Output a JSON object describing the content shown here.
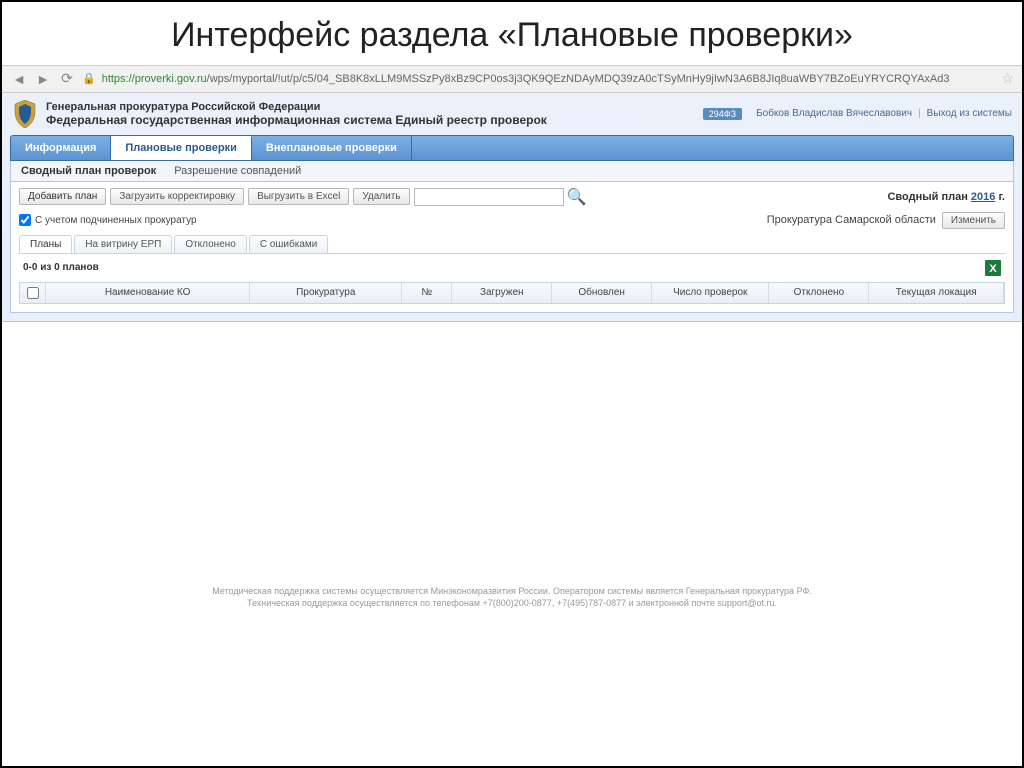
{
  "slide_title": "Интерфейс раздела «Плановые проверки»",
  "browser": {
    "url_host": "https://proverki.gov.ru",
    "url_path": "/wps/myportal/!ut/p/c5/04_SB8K8xLLM9MSSzPy8xBz9CP0os3j3QK9QEzNDAyMDQ39zA0cTSyMnHy9jIwN3A6B8JIq8uaWBY7BZoEuYRYCRQYAxAd3"
  },
  "app": {
    "title_line1": "Генеральная прокуратура Российской Федерации",
    "title_line2": "Федеральная государственная информационная система Единый реестр проверок",
    "badge": "294ФЗ",
    "user_name": "Бобков Владислав Вячеславович",
    "logout": "Выход из системы"
  },
  "primary_tabs": {
    "info": "Информация",
    "planned": "Плановые проверки",
    "unplanned": "Внеплановые проверки"
  },
  "secondary_tabs": {
    "svod": "Сводный план проверок",
    "resolve": "Разрешение совпадений"
  },
  "toolbar": {
    "add": "Добавить план",
    "upload": "Загрузить корректировку",
    "export": "Выгрузить в Excel",
    "delete": "Удалить"
  },
  "summary_plan_label": "Сводный план",
  "summary_plan_year": "2016",
  "summary_plan_suffix": "г.",
  "checkbox_label": "С учетом подчиненных прокуратур",
  "region_label": "Прокуратура Самарской области",
  "change_btn": "Изменить",
  "sub_tabs": {
    "plans": "Планы",
    "vitrina": "На витрину ЕРП",
    "rejected": "Отклонено",
    "errors": "С ошибками"
  },
  "count_text": "0-0 из 0 планов",
  "columns": {
    "name": "Наименование КО",
    "prok": "Прокуратура",
    "num": "№",
    "loaded": "Загружен",
    "updated": "Обновлен",
    "count": "Число проверок",
    "rejected": "Отклонено",
    "location": "Текущая локация"
  },
  "footer1": "Методическая поддержка системы осуществляется Минэкономразвития России. Оператором системы является Генеральная прокуратура РФ.",
  "footer2": "Техническая поддержка осуществляется по телефонам +7(800)200-0877, +7(495)787-0877 и электронной почте support@ot.ru."
}
